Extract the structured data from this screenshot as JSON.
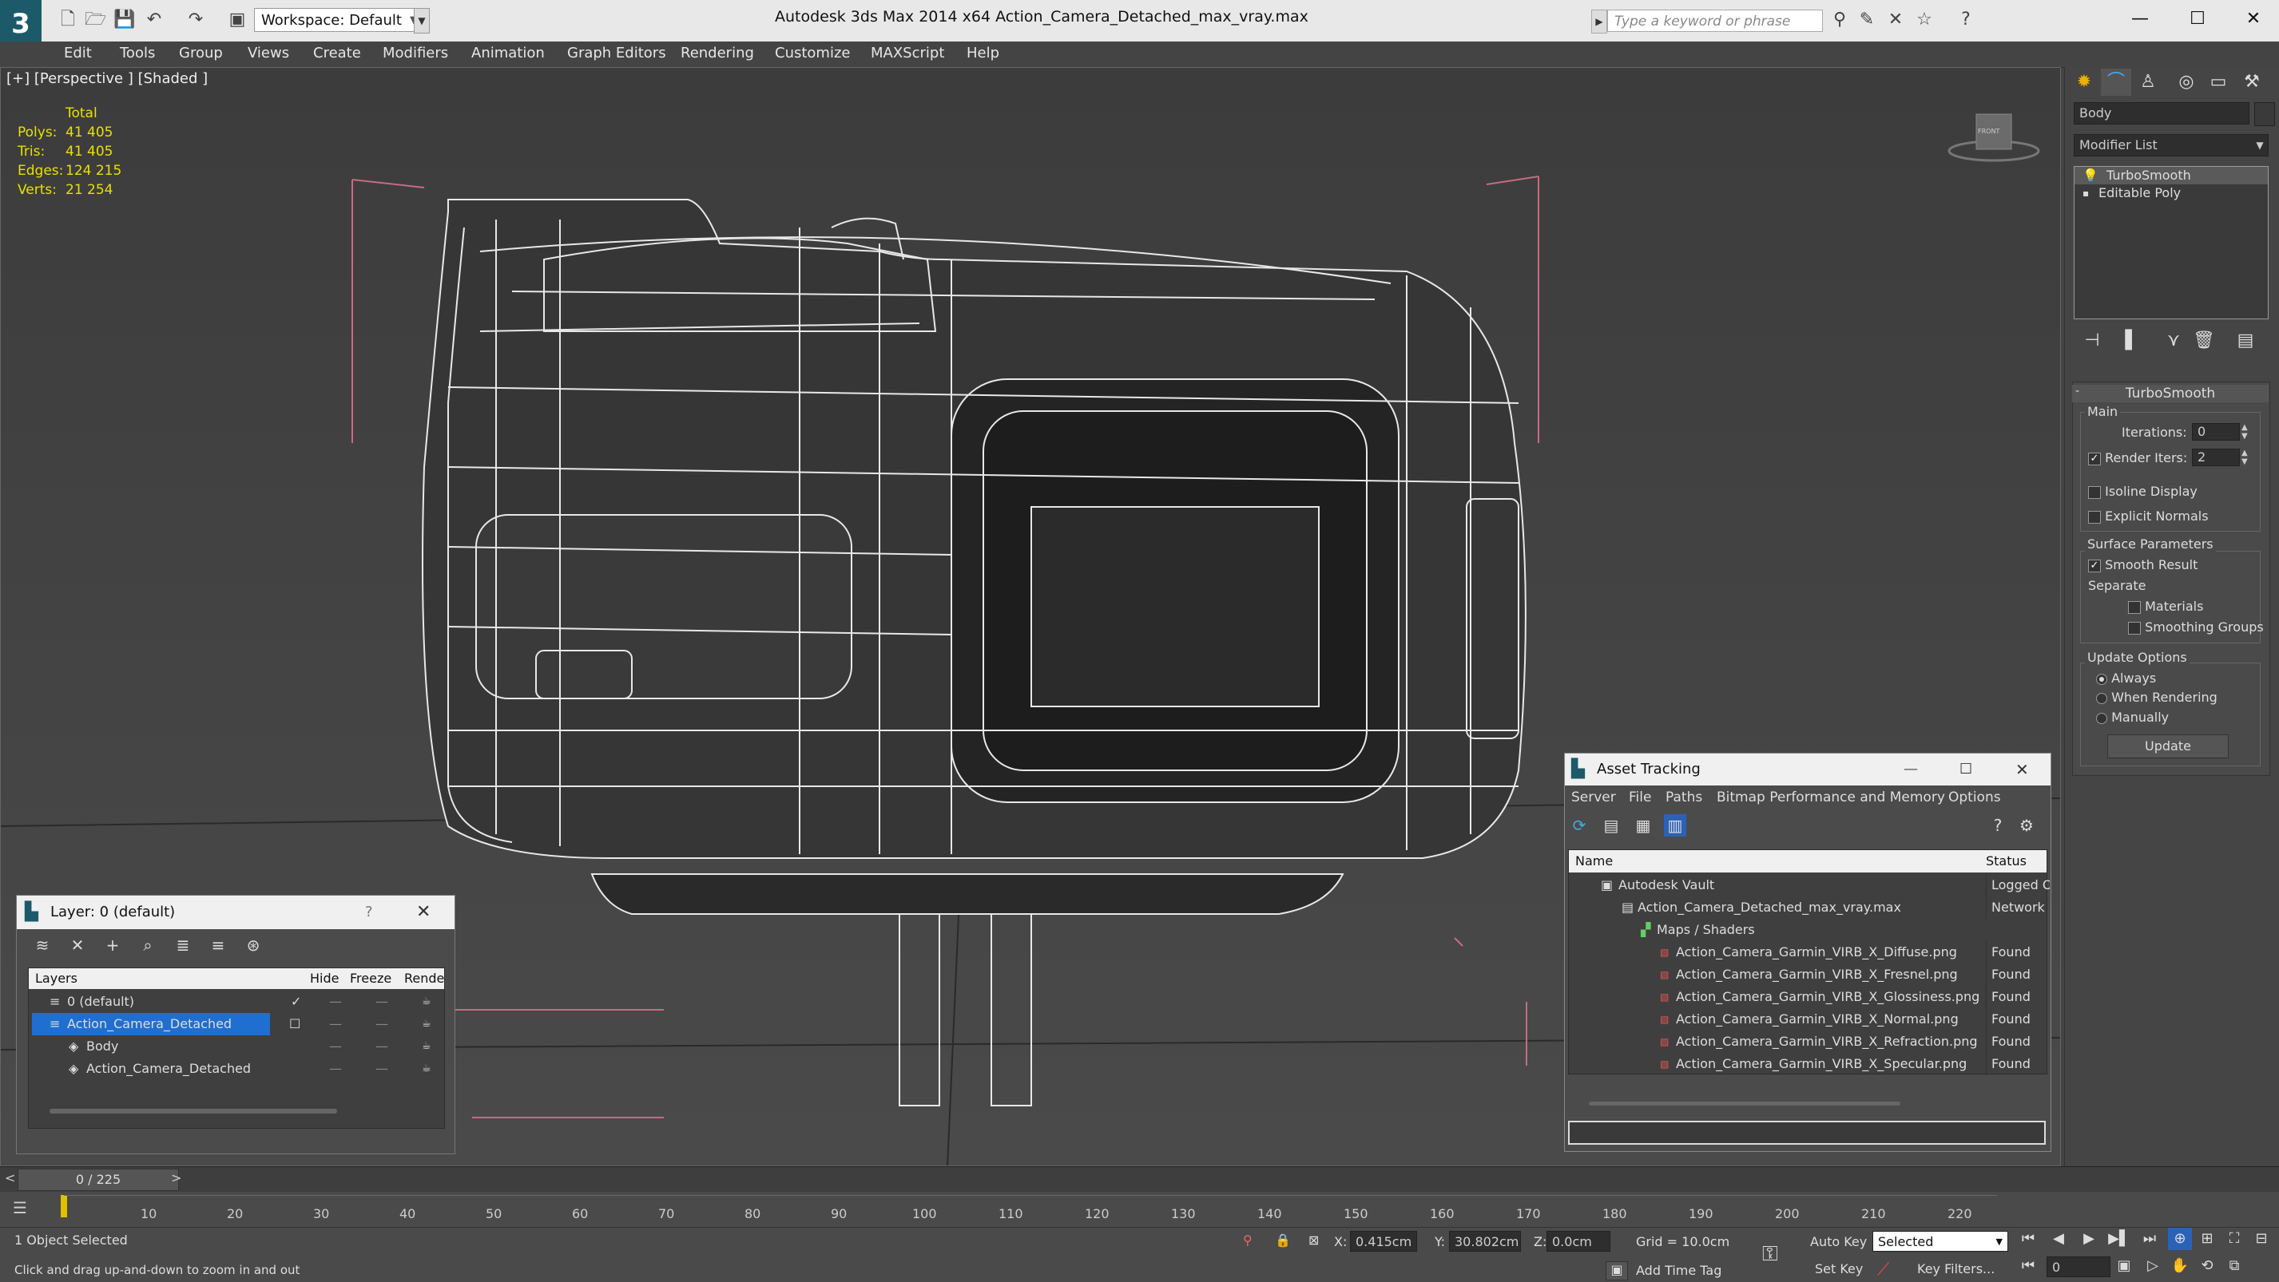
{
  "titlebar": {
    "workspace": "Workspace: Default",
    "app_title": "Autodesk 3ds Max  2014 x64     Action_Camera_Detached_max_vray.max",
    "search_placeholder": "Type a keyword or phrase"
  },
  "menu": [
    "Edit",
    "Tools",
    "Group",
    "Views",
    "Create",
    "Modifiers",
    "Animation",
    "Graph Editors",
    "Rendering",
    "Customize",
    "MAXScript",
    "Help"
  ],
  "viewport": {
    "label": "[+] [Perspective ] [Shaded ]",
    "stats_header": "Total",
    "stats": [
      {
        "k": "Polys:",
        "v": "41 405"
      },
      {
        "k": "Tris:",
        "v": "41 405"
      },
      {
        "k": "Edges:",
        "v": "124 215"
      },
      {
        "k": "Verts:",
        "v": "21 254"
      }
    ],
    "viewcube_label": "FRONT"
  },
  "command_panel": {
    "object_name": "Body",
    "modifier_list": "Modifier List",
    "stack": [
      "TurboSmooth",
      "Editable Poly"
    ],
    "rollout_title": "TurboSmooth",
    "main_label": "Main",
    "iterations_label": "Iterations:",
    "iterations_value": "0",
    "render_iters_label": "Render Iters:",
    "render_iters_value": "2",
    "isoline_label": "Isoline Display",
    "explicit_label": "Explicit Normals",
    "surface_label": "Surface Parameters",
    "smooth_label": "Smooth Result",
    "separate_label": "Separate",
    "materials_label": "Materials",
    "smoothing_label": "Smoothing Groups",
    "update_label": "Update Options",
    "always_label": "Always",
    "when_rendering_label": "When Rendering",
    "manually_label": "Manually",
    "update_button": "Update"
  },
  "layer_dialog": {
    "title": "Layer: 0 (default)",
    "help": "?",
    "columns": [
      "Layers",
      "Hide",
      "Freeze",
      "Rende"
    ],
    "rows": [
      {
        "name": "0 (default)",
        "indent": 0
      },
      {
        "name": "Action_Camera_Detached",
        "indent": 0
      },
      {
        "name": "Body",
        "indent": 1
      },
      {
        "name": "Action_Camera_Detached",
        "indent": 1
      }
    ]
  },
  "asset_dialog": {
    "title": "Asset Tracking",
    "menu": [
      "Server",
      "File",
      "Paths",
      "Bitmap Performance and Memory",
      "Options"
    ],
    "col_name": "Name",
    "col_status": "Status",
    "rows": [
      {
        "name": "Autodesk Vault",
        "status": "Logged O"
      },
      {
        "name": "Action_Camera_Detached_max_vray.max",
        "status": "Network F"
      },
      {
        "name": "Maps / Shaders",
        "status": ""
      },
      {
        "name": "Action_Camera_Garmin_VIRB_X_Diffuse.png",
        "status": "Found"
      },
      {
        "name": "Action_Camera_Garmin_VIRB_X_Fresnel.png",
        "status": "Found"
      },
      {
        "name": "Action_Camera_Garmin_VIRB_X_Glossiness.png",
        "status": "Found"
      },
      {
        "name": "Action_Camera_Garmin_VIRB_X_Normal.png",
        "status": "Found"
      },
      {
        "name": "Action_Camera_Garmin_VIRB_X_Refraction.png",
        "status": "Found"
      },
      {
        "name": "Action_Camera_Garmin_VIRB_X_Specular.png",
        "status": "Found"
      }
    ]
  },
  "timeline": {
    "frame": "0 / 225",
    "ticks": [
      "10",
      "20",
      "30",
      "40",
      "50",
      "60",
      "70",
      "80",
      "90",
      "100",
      "110",
      "120",
      "130",
      "140",
      "150",
      "160",
      "170",
      "180",
      "190",
      "200",
      "210",
      "220"
    ]
  },
  "status": {
    "selected": "1 Object Selected",
    "prompt": "Click and drag up-and-down to zoom in and out",
    "x_label": "X:",
    "x_value": "0.415cm",
    "y_label": "Y:",
    "y_value": "30.802cm",
    "z_label": "Z:",
    "z_value": "0.0cm",
    "grid": "Grid = 10.0cm",
    "add_time_tag": "Add Time Tag",
    "auto_key": "Auto Key",
    "selected_dropdown": "Selected",
    "set_key": "Set Key",
    "key_filters": "Key Filters...",
    "frame_field": "0"
  }
}
